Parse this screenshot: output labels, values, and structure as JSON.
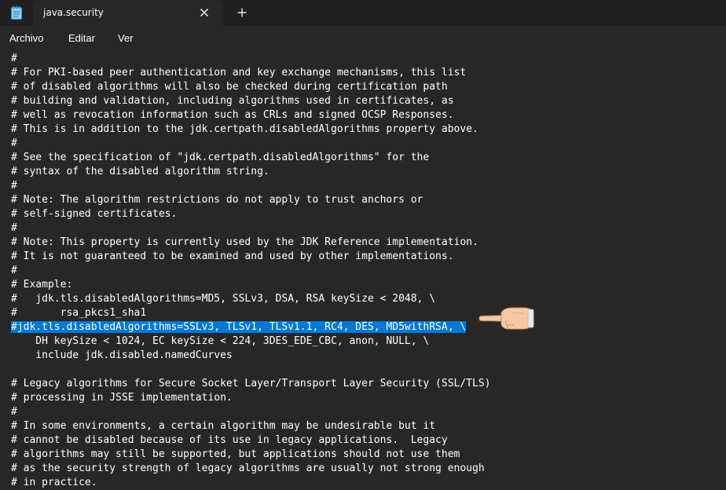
{
  "tab": {
    "title": "java.security"
  },
  "icons": {
    "app": "notepad-icon",
    "close": "close-icon",
    "new_tab": "plus-icon",
    "pointer": "pointing-hand-icon"
  },
  "menu": {
    "items": [
      "Archivo",
      "Editar",
      "Ver"
    ]
  },
  "colors": {
    "selection": "#0078d7",
    "background": "#272727",
    "text": "#ffffff"
  },
  "editor": {
    "selected_line_index": 19,
    "lines": [
      "#",
      "# For PKI-based peer authentication and key exchange mechanisms, this list",
      "# of disabled algorithms will also be checked during certification path",
      "# building and validation, including algorithms used in certificates, as",
      "# well as revocation information such as CRLs and signed OCSP Responses.",
      "# This is in addition to the jdk.certpath.disabledAlgorithms property above.",
      "#",
      "# See the specification of \"jdk.certpath.disabledAlgorithms\" for the",
      "# syntax of the disabled algorithm string.",
      "#",
      "# Note: The algorithm restrictions do not apply to trust anchors or",
      "# self-signed certificates.",
      "#",
      "# Note: This property is currently used by the JDK Reference implementation.",
      "# It is not guaranteed to be examined and used by other implementations.",
      "#",
      "# Example:",
      "#   jdk.tls.disabledAlgorithms=MD5, SSLv3, DSA, RSA keySize < 2048, \\",
      "#       rsa_pkcs1_sha1",
      "#jdk.tls.disabledAlgorithms=SSLv3, TLSv1, TLSv1.1, RC4, DES, MD5withRSA, \\",
      "    DH keySize < 1024, EC keySize < 224, 3DES_EDE_CBC, anon, NULL, \\",
      "    include jdk.disabled.namedCurves",
      "",
      "# Legacy algorithms for Secure Socket Layer/Transport Layer Security (SSL/TLS)",
      "# processing in JSSE implementation.",
      "#",
      "# In some environments, a certain algorithm may be undesirable but it",
      "# cannot be disabled because of its use in legacy applications.  Legacy",
      "# algorithms may still be supported, but applications should not use them",
      "# as the security strength of legacy algorithms are usually not strong enough",
      "# in practice."
    ]
  }
}
